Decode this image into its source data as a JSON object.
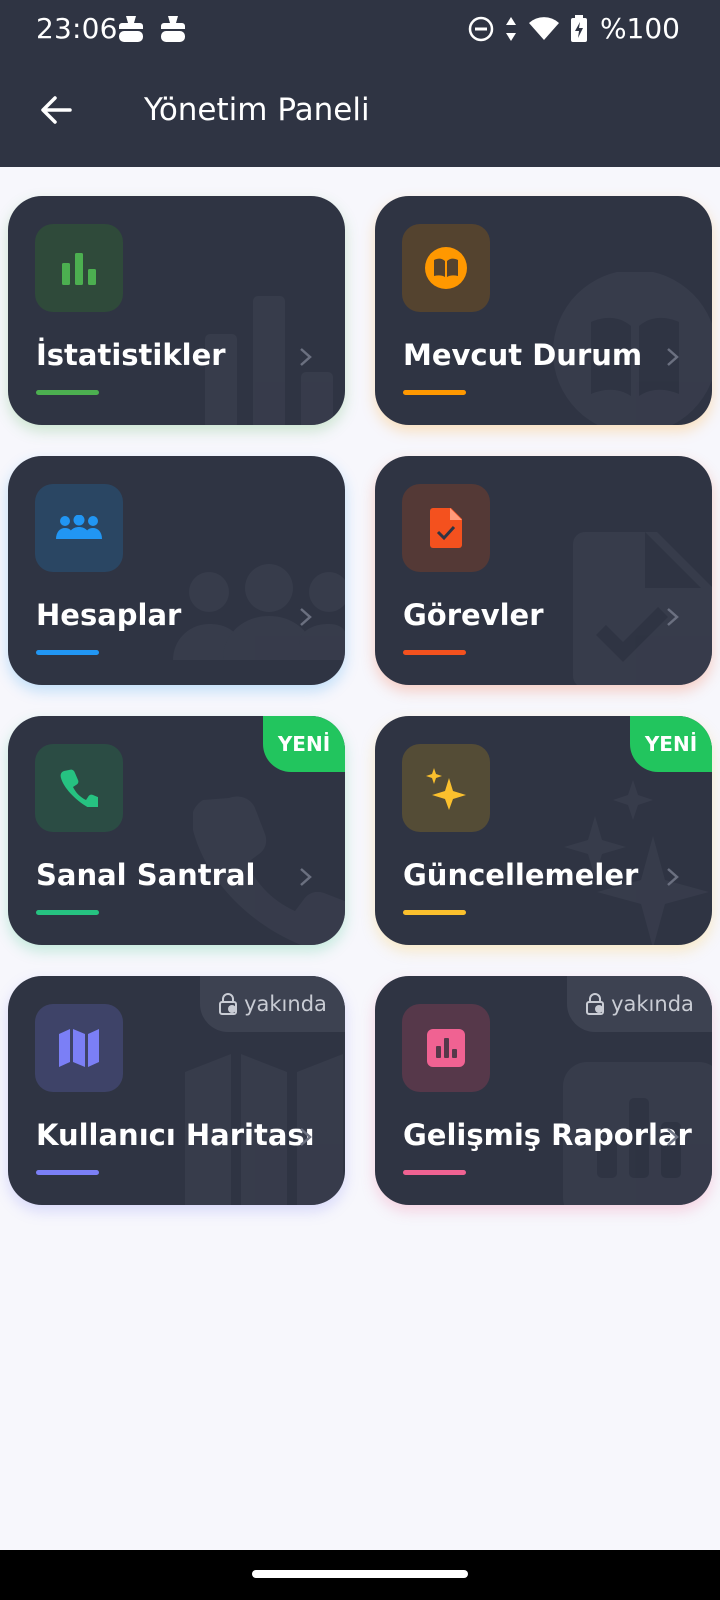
{
  "status": {
    "time": "23:06",
    "battery": "%100"
  },
  "header": {
    "title": "Yönetim Paneli"
  },
  "cards": [
    {
      "label": "İstatistikler",
      "accent": "#4caf50",
      "icon": "bar-chart-icon"
    },
    {
      "label": "Mevcut Durum",
      "accent": "#ff9800",
      "icon": "book-icon"
    },
    {
      "label": "Hesaplar",
      "accent": "#2196f3",
      "icon": "people-icon"
    },
    {
      "label": "Görevler",
      "accent": "#f4511e",
      "icon": "task-document-icon"
    },
    {
      "label": "Sanal Santral",
      "accent": "#26c281",
      "icon": "phone-icon",
      "badge": "YENİ"
    },
    {
      "label": "Güncellemeler",
      "accent": "#fbc02d",
      "icon": "sparkles-icon",
      "badge": "YENİ"
    },
    {
      "label": "Kullanıcı Haritası",
      "accent": "#7b7ff6",
      "icon": "map-icon",
      "badge": "yakında"
    },
    {
      "label": "Gelişmiş Raporlar",
      "accent": "#f06292",
      "icon": "report-icon",
      "badge": "yakında"
    }
  ]
}
